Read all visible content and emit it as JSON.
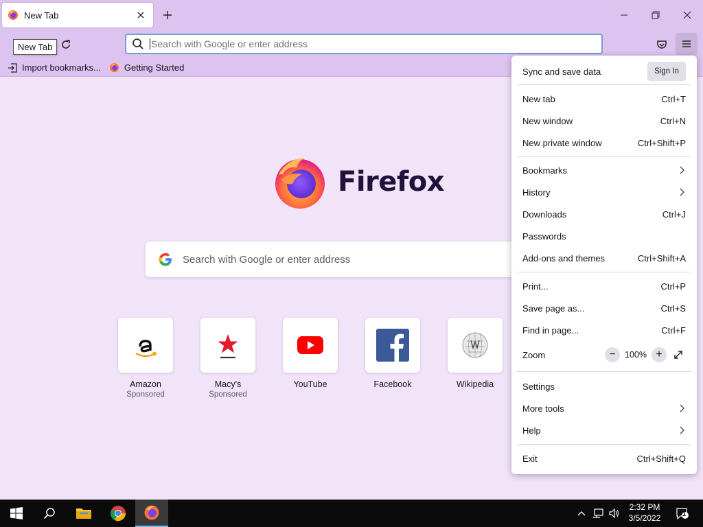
{
  "tab": {
    "title": "New Tab",
    "tooltip": "New Tab"
  },
  "urlbar": {
    "placeholder": "Search with Google or enter address"
  },
  "bookmarks": [
    {
      "label": "Import bookmarks...",
      "icon": "import-icon"
    },
    {
      "label": "Getting Started",
      "icon": "firefox-icon"
    }
  ],
  "content": {
    "wordmark": "Firefox",
    "search_placeholder": "Search with Google or enter address",
    "tiles": [
      {
        "name": "Amazon",
        "sponsored": "Sponsored",
        "icon": "amazon-icon"
      },
      {
        "name": "Macy's",
        "sponsored": "Sponsored",
        "icon": "macys-icon"
      },
      {
        "name": "YouTube",
        "sponsored": "",
        "icon": "youtube-icon"
      },
      {
        "name": "Facebook",
        "sponsored": "",
        "icon": "facebook-icon"
      },
      {
        "name": "Wikipedia",
        "sponsored": "",
        "icon": "wikipedia-icon"
      }
    ]
  },
  "menu": {
    "sync_label": "Sync and save data",
    "signin_label": "Sign In",
    "new_tab": {
      "label": "New tab",
      "shortcut": "Ctrl+T"
    },
    "new_window": {
      "label": "New window",
      "shortcut": "Ctrl+N"
    },
    "new_private": {
      "label": "New private window",
      "shortcut": "Ctrl+Shift+P"
    },
    "bookmarks": {
      "label": "Bookmarks"
    },
    "history": {
      "label": "History"
    },
    "downloads": {
      "label": "Downloads",
      "shortcut": "Ctrl+J"
    },
    "passwords": {
      "label": "Passwords"
    },
    "addons": {
      "label": "Add-ons and themes",
      "shortcut": "Ctrl+Shift+A"
    },
    "print": {
      "label": "Print...",
      "shortcut": "Ctrl+P"
    },
    "save_page": {
      "label": "Save page as...",
      "shortcut": "Ctrl+S"
    },
    "find": {
      "label": "Find in page...",
      "shortcut": "Ctrl+F"
    },
    "zoom": {
      "label": "Zoom",
      "minus": "−",
      "value": "100%",
      "plus": "+"
    },
    "settings": {
      "label": "Settings"
    },
    "more_tools": {
      "label": "More tools"
    },
    "help": {
      "label": "Help"
    },
    "exit": {
      "label": "Exit",
      "shortcut": "Ctrl+Shift+Q"
    }
  },
  "taskbar": {
    "time": "2:32 PM",
    "date": "3/5/2022",
    "notification_count": "1"
  },
  "colors": {
    "titlebar": "#ddc4f0",
    "content_bg": "#f1e4f9",
    "accent": "#7a9bd0"
  }
}
